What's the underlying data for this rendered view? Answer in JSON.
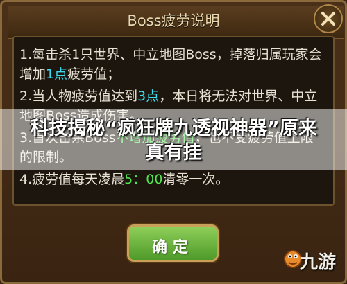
{
  "dialog": {
    "title": "Boss疲劳说明",
    "close_label": "✕",
    "confirm_label": "确定"
  },
  "rules": [
    {
      "before": "1.每击杀1只世界、中立地图Boss，掉落归属玩家会增加",
      "highlight": "1点",
      "after": "疲劳值；"
    },
    {
      "before": "2.当人物疲劳值达到",
      "highlight": "3点",
      "after": "，本日将无法对世界、中立地图Boss造成伤害。"
    },
    {
      "before": "3.首次击杀Boss",
      "highlight": "不增加疲劳值",
      "after": "，也不受疲劳值上限的限制。"
    },
    {
      "before": "4.疲劳值每天凌晨",
      "highlight": "5：00",
      "after": "清零一次。"
    }
  ],
  "overlay_banner": "科技揭秘“疯狂牌九透视神器”原来真有挂",
  "watermark": "九游",
  "colors": {
    "highlight_cyan": "#3fdcf0",
    "highlight_green": "#4fe84f",
    "button_green": "#6ab83a"
  }
}
